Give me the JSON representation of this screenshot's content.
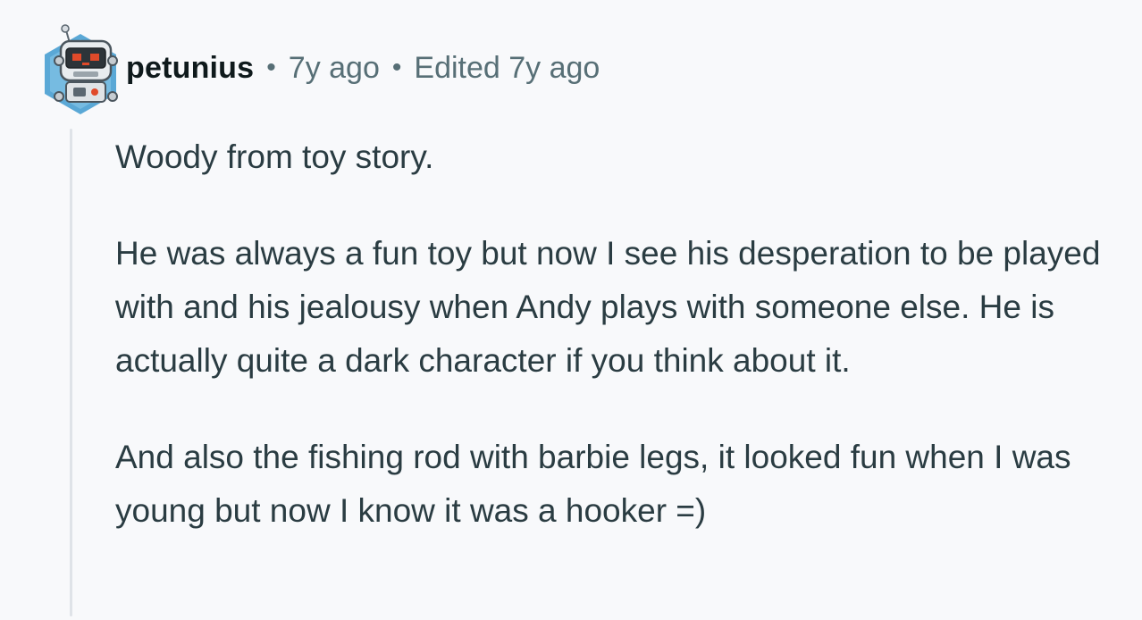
{
  "comment": {
    "author": "petunius",
    "separator": "•",
    "posted": "7y ago",
    "edited": "Edited 7y ago",
    "paragraphs": [
      "Woody from toy story.",
      "He was always a fun toy but now I see his desperation to be played with and his jealousy when Andy plays with someone else. He is actually quite a dark character if you think about it.",
      "And also the fishing rod with barbie legs, it looked fun when I was young but now I know it was a hooker =)"
    ]
  },
  "colors": {
    "background": "#f8f9fb",
    "author": "#0f1a1c",
    "meta": "#576f76",
    "body_text": "#2a3c42",
    "thread_line": "#dfe3e8",
    "avatar_hex": "#5aa8d6"
  },
  "icons": {
    "avatar": "robot-avatar-icon"
  }
}
